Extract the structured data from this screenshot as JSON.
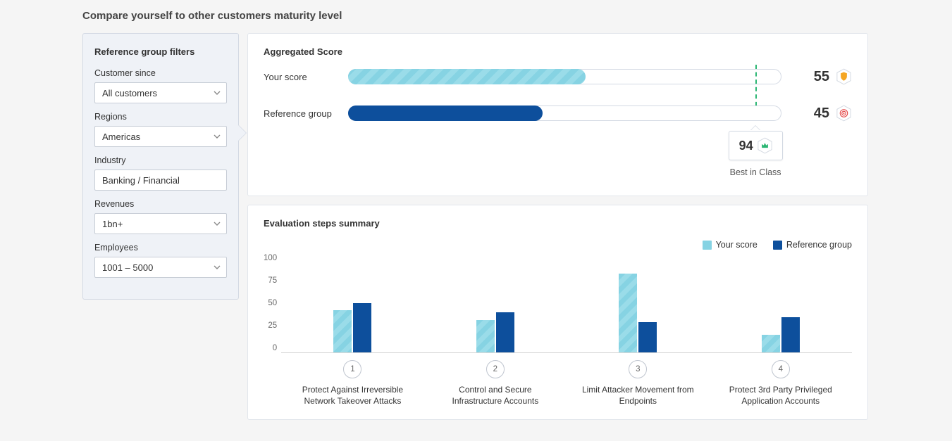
{
  "page_title": "Compare yourself to other customers maturity level",
  "sidebar": {
    "title": "Reference group filters",
    "filters": [
      {
        "label": "Customer since",
        "value": "All customers",
        "has_chevron": true
      },
      {
        "label": "Regions",
        "value": "Americas",
        "has_chevron": true
      },
      {
        "label": "Industry",
        "value": "Banking / Financial",
        "has_chevron": false
      },
      {
        "label": "Revenues",
        "value": "1bn+",
        "has_chevron": true
      },
      {
        "label": "Employees",
        "value": "1001 – 5000",
        "has_chevron": true
      }
    ]
  },
  "aggregated": {
    "title": "Aggregated Score",
    "rows": [
      {
        "label": "Your score",
        "value": 55,
        "style": "yours",
        "icon": "shield"
      },
      {
        "label": "Reference group",
        "value": 45,
        "style": "ref",
        "icon": "target"
      }
    ],
    "best_in_class_value": 94,
    "best_in_class_label": "Best in Class",
    "scale_max": 100
  },
  "evaluation": {
    "title": "Evaluation steps summary",
    "legend": [
      {
        "label": "Your score",
        "style": "yours"
      },
      {
        "label": "Reference group",
        "style": "ref"
      }
    ]
  },
  "chart_data": {
    "type": "bar",
    "ylim": [
      0,
      100
    ],
    "yticks": [
      0,
      25,
      50,
      75,
      100
    ],
    "categories": [
      {
        "n": "1",
        "label": "Protect Against Irreversible Network Takeover Attacks"
      },
      {
        "n": "2",
        "label": "Control and Secure Infrastructure Accounts"
      },
      {
        "n": "3",
        "label": "Limit Attacker Movement from Endpoints"
      },
      {
        "n": "4",
        "label": "Protect 3rd Party Privileged Application Accounts"
      }
    ],
    "series": [
      {
        "name": "Your score",
        "style": "yours",
        "values": [
          43,
          33,
          80,
          18
        ]
      },
      {
        "name": "Reference group",
        "style": "ref",
        "values": [
          50,
          41,
          31,
          36
        ]
      }
    ]
  }
}
